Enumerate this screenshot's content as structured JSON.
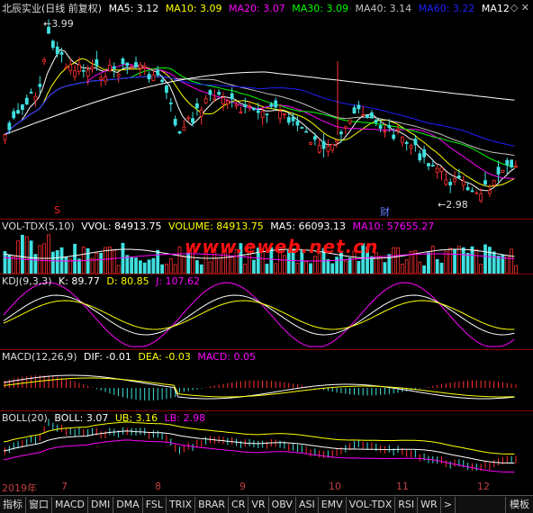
{
  "main": {
    "title": "北辰实业(日线 前复权)",
    "ma": [
      {
        "label": "MA5: 3.12",
        "color": "#ffffff"
      },
      {
        "label": "MA10: 3.09",
        "color": "#ffff00"
      },
      {
        "label": "MA20: 3.07",
        "color": "#ff00ff"
      },
      {
        "label": "MA30: 3.09",
        "color": "#00ff00"
      },
      {
        "label": "MA40: 3.14",
        "color": "#c0c0c0"
      },
      {
        "label": "MA60: 3.22",
        "color": "#0000ff"
      },
      {
        "label": "MA12",
        "color": "#ffffff"
      }
    ],
    "high_label": "3.99",
    "low_label": "2.98",
    "marker_s": "S",
    "marker_cai": "财"
  },
  "volume": {
    "name": "VOL-TDX(5,10)",
    "vvol": "VVOL: 84913.75",
    "volume": "VOLUME: 84913.75",
    "ma5": "MA5: 66093.13",
    "ma10": "MA10: 57655.27"
  },
  "watermark": "www.eweb.net.cn",
  "kdj": {
    "name": "KDJ(9,3,3)",
    "k": "K: 89.77",
    "d": "D: 80.85",
    "j": "J: 107.62"
  },
  "macd": {
    "name": "MACD(12,26,9)",
    "dif": "DIF: -0.01",
    "dea": "DEA: -0.03",
    "macd": "MACD: 0.05"
  },
  "boll": {
    "name": "BOLL(20)",
    "boll": "BOLL: 3.07",
    "ub": "UB: 3.16",
    "lb": "LB: 2.98"
  },
  "xaxis": [
    "2019年",
    "7",
    "8",
    "9",
    "10",
    "11",
    "12"
  ],
  "tabs": [
    "指标",
    "窗口",
    "MACD",
    "DMI",
    "DMA",
    "FSL",
    "TRIX",
    "BRAR",
    "CR",
    "VR",
    "OBV",
    "ASI",
    "EMV",
    "VOL-TDX",
    "RSI",
    "WR",
    ">"
  ],
  "mode": "模板"
}
